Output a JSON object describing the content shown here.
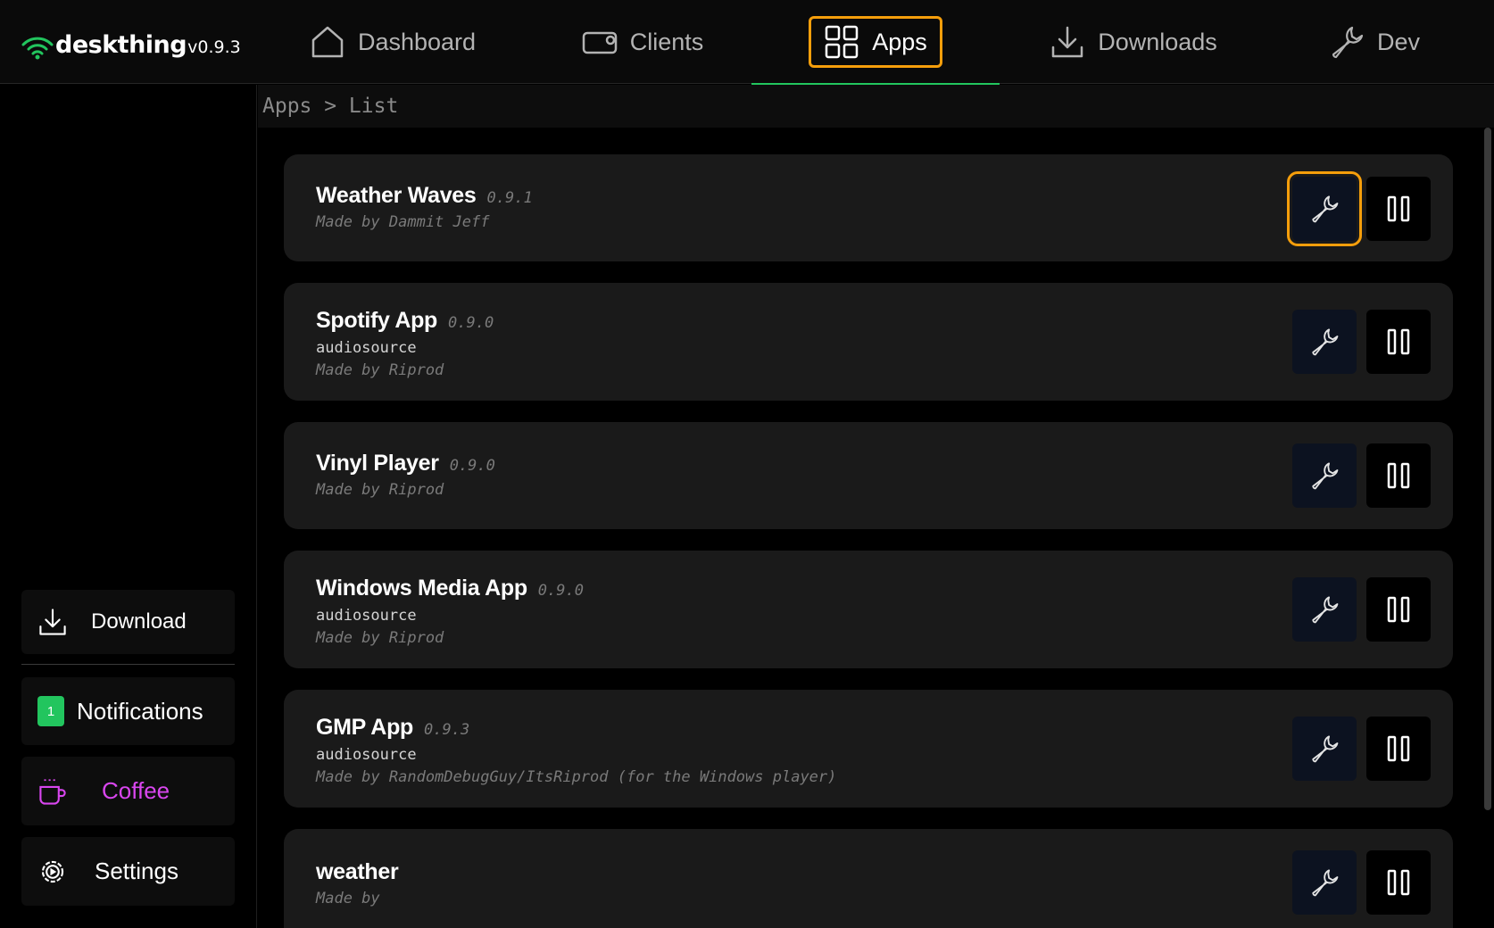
{
  "brand": {
    "name": "deskthing",
    "version": "v0.9.3",
    "accent": "#22c55e"
  },
  "nav": [
    {
      "label": "Dashboard",
      "icon": "home-icon",
      "active": false
    },
    {
      "label": "Clients",
      "icon": "client-device-icon",
      "active": false
    },
    {
      "label": "Apps",
      "icon": "grid-icon",
      "active": true
    },
    {
      "label": "Downloads",
      "icon": "download-icon",
      "active": false
    },
    {
      "label": "Dev",
      "icon": "wrench-icon",
      "active": false
    }
  ],
  "sidebar": {
    "download": "Download",
    "notifications": {
      "label": "Notifications",
      "count": "1"
    },
    "coffee": {
      "label": "Coffee",
      "color": "#d946ef"
    },
    "settings": "Settings"
  },
  "breadcrumb": "Apps > List",
  "apps": [
    {
      "name": "Weather Waves",
      "version": "0.9.1",
      "tag": "",
      "author": "Made by Dammit Jeff"
    },
    {
      "name": "Spotify App",
      "version": "0.9.0",
      "tag": "audiosource",
      "author": "Made by Riprod"
    },
    {
      "name": "Vinyl Player",
      "version": "0.9.0",
      "tag": "",
      "author": "Made by Riprod"
    },
    {
      "name": "Windows Media App",
      "version": "0.9.0",
      "tag": "audiosource",
      "author": "Made by Riprod"
    },
    {
      "name": "GMP App",
      "version": "0.9.3",
      "tag": "audiosource",
      "author": "Made by RandomDebugGuy/ItsRiprod (for the Windows player)"
    },
    {
      "name": "weather",
      "version": "",
      "tag": "",
      "author": "Made by"
    }
  ],
  "colors": {
    "focus_outline": "#f59e0b",
    "card_bg": "#1a1a1a",
    "settings_button_bg": "#0c1220"
  }
}
